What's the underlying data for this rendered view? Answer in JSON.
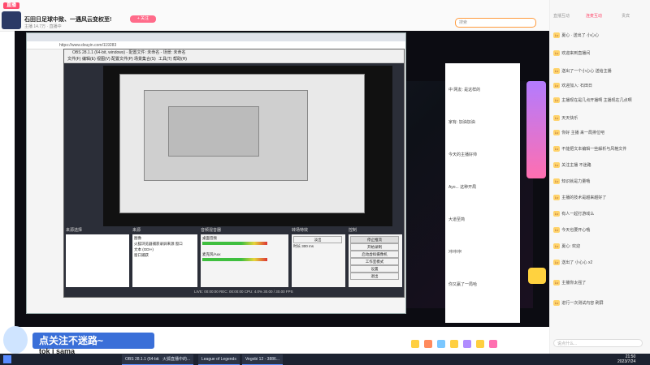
{
  "header": {
    "logo": "直播",
    "title": "石田日足球中致、一遇风云变权至!",
    "meta": "主播 14.7万 · 直播中",
    "follow_label": "+ 关注",
    "search_placeholder": "搜索"
  },
  "browser": {
    "url": "https://www.douyin.com/119283"
  },
  "obs": {
    "title": "OBS 28.1.1 (64-bit, windows) - 配置文件: 未命名 - 场景: 未命名",
    "menu": [
      "文件(F)",
      "编辑(E)",
      "视图(V)",
      "配置文件(P)",
      "场景集合(S)",
      "工具(T)",
      "帮助(H)"
    ],
    "docks": {
      "scenes_title": "来源选择",
      "sources_title": "来源",
      "sources": [
        "图像",
        "火狐浏览器捕获录屏来源 窗口",
        "文本 (GDI+)",
        "窗口捕获"
      ],
      "mixer_title": "音频混音器",
      "mixer_tracks": [
        "桌面音频",
        "麦克风/Aux"
      ],
      "transition_title": "转场特效",
      "transition_value": "淡出",
      "duration_label": "时长 300 ms",
      "controls_title": "控制",
      "controls": [
        "停止推流",
        "开始录制",
        "启动虚拟摄像机",
        "工作室模式",
        "设置",
        "退出"
      ]
    },
    "status": "LIVE: 00:00:00   REC: 00:00:00   CPU: 4.0%  30.00 / 30.00 FPS"
  },
  "chat_side": {
    "lines": [
      "中 网友: 是这样的",
      "家有: 加油加油",
      "今天的主播好帅",
      "Ayo... 这种开局",
      "大道至简",
      "冲冲冲!",
      "你又赢了一局哈"
    ]
  },
  "chat_main": {
    "tabs": [
      "直播互动",
      "连麦互动",
      "贵宾"
    ],
    "lines": [
      "夏心 · 送出了 小心心",
      "欢迎来到直播间",
      "送出了一个小心心 送给主播",
      "欢迎加入: 石田日",
      "主播现在是几点开播啊 主播现在几点啊",
      "天天快乐",
      "你好 主播 来一局排位吧",
      "不能把文本编辑一些解析与风格文件",
      "关注主播 不迷路",
      "知识就是力量哦",
      "主播的技术是越来越好了",
      "有人一起打游戏么",
      "今天也要开心哦",
      "夏心: 欢迎",
      "送出了 小心心 x2",
      "主播你太强了",
      "进行一次测试内容 刷屏"
    ],
    "input_placeholder": "说点什么..."
  },
  "overlay": {
    "subscribe_text": "点关注不迷路~",
    "tiktok_label": "tok i sama"
  },
  "taskbar": {
    "items": [
      "OBS 28.1.1 (64-bit...",
      "火狐直播中的...",
      "League of Legends",
      "Vegobi 12 - 3886..."
    ],
    "time": "21:50",
    "date": "2023/7/24"
  },
  "colors": {
    "accent": "#ff4b6e",
    "stage": "#0c0c12",
    "taskbar": "#1c2230"
  }
}
